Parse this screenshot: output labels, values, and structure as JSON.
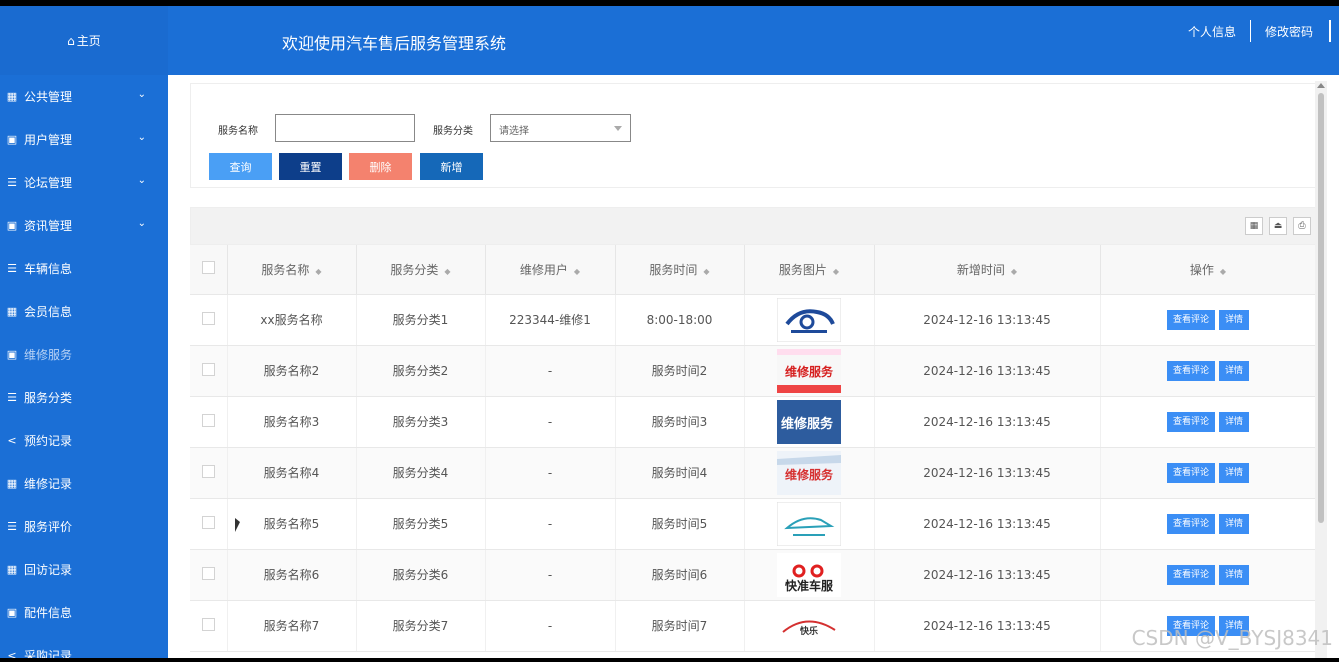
{
  "header": {
    "title": "欢迎使用汽车售后服务管理系统",
    "links": [
      "个人信息",
      "修改密码"
    ]
  },
  "sidebar": {
    "home": "主页",
    "items": [
      {
        "label": "公共管理",
        "icon": "grid-icon",
        "expandable": true
      },
      {
        "label": "用户管理",
        "icon": "card-icon",
        "expandable": true
      },
      {
        "label": "论坛管理",
        "icon": "list-icon",
        "expandable": true
      },
      {
        "label": "资讯管理",
        "icon": "card-icon",
        "expandable": true
      },
      {
        "label": "车辆信息",
        "icon": "list-icon",
        "expandable": false
      },
      {
        "label": "会员信息",
        "icon": "grid-icon",
        "expandable": false
      },
      {
        "label": "维修服务",
        "icon": "card-icon",
        "expandable": false,
        "active": true
      },
      {
        "label": "服务分类",
        "icon": "list-icon",
        "expandable": false
      },
      {
        "label": "预约记录",
        "icon": "share-icon",
        "expandable": false
      },
      {
        "label": "维修记录",
        "icon": "grid-icon",
        "expandable": false
      },
      {
        "label": "服务评价",
        "icon": "list-icon",
        "expandable": false
      },
      {
        "label": "回访记录",
        "icon": "grid-icon",
        "expandable": false
      },
      {
        "label": "配件信息",
        "icon": "card-icon",
        "expandable": false
      },
      {
        "label": "采购记录",
        "icon": "share-icon",
        "expandable": false
      }
    ]
  },
  "search": {
    "name_label": "服务名称",
    "name_value": "",
    "category_label": "服务分类",
    "category_placeholder": "请选择"
  },
  "buttons": {
    "query": "查询",
    "reset": "重置",
    "delete": "删除",
    "add": "新增"
  },
  "colors": {
    "primary": "#1b6fd6",
    "query": "#4a9ff5",
    "reset": "#0d3e8a",
    "delete": "#f4826e",
    "add": "#1568b8",
    "op": "#3b8ef5"
  },
  "table": {
    "columns": [
      "服务名称",
      "服务分类",
      "维修用户",
      "服务时间",
      "服务图片",
      "新增时间",
      "操作"
    ],
    "rows": [
      {
        "name": "xx服务名称",
        "category": "服务分类1",
        "user": "223344-维修1",
        "time": "8:00-18:00",
        "image": "car-logo-blue",
        "created": "2024-12-16 13:13:45"
      },
      {
        "name": "服务名称2",
        "category": "服务分类2",
        "user": "-",
        "time": "服务时间2",
        "image": "banner-red",
        "created": "2024-12-16 13:13:45"
      },
      {
        "name": "服务名称3",
        "category": "服务分类3",
        "user": "-",
        "time": "服务时间3",
        "image": "banner-blue",
        "created": "2024-12-16 13:13:45"
      },
      {
        "name": "服务名称4",
        "category": "服务分类4",
        "user": "-",
        "time": "服务时间4",
        "image": "banner-white-red",
        "created": "2024-12-16 13:13:45"
      },
      {
        "name": "服务名称5",
        "category": "服务分类5",
        "user": "-",
        "time": "服务时间5",
        "image": "car-logo-teal",
        "created": "2024-12-16 13:13:45"
      },
      {
        "name": "服务名称6",
        "category": "服务分类6",
        "user": "-",
        "time": "服务时间6",
        "image": "logo-kuaizhun",
        "created": "2024-12-16 13:13:45"
      },
      {
        "name": "服务名称7",
        "category": "服务分类7",
        "user": "-",
        "time": "服务时间7",
        "image": "logo-kuaile",
        "created": "2024-12-16 13:13:45"
      }
    ],
    "actions": [
      "查看评论",
      "详情"
    ]
  },
  "image_text": {
    "banner": "维修服务",
    "kuaizhun": "快准车服",
    "kuaile": "快乐"
  },
  "watermark": "CSDN @V_BYSJ8341"
}
